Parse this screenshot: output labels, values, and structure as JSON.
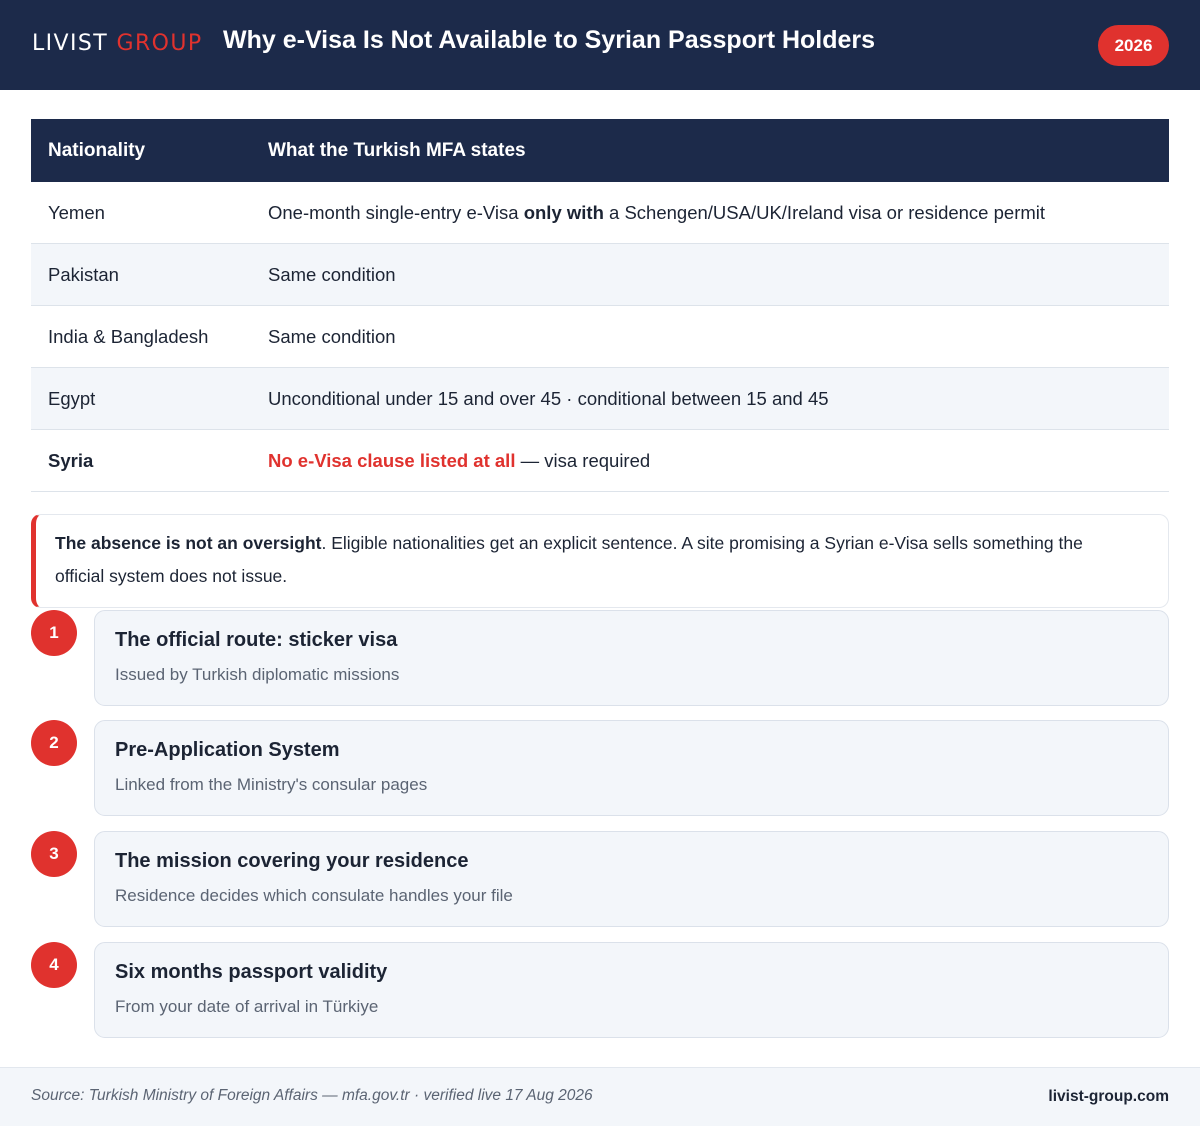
{
  "header": {
    "brand_main": "LIVIST",
    "brand_accent": "GROUP",
    "title": "Why e-Visa Is Not Available to Syrian Passport Holders",
    "year": "2026"
  },
  "table": {
    "col1": "Nationality",
    "col2": "What the Turkish MFA states",
    "rows": [
      {
        "nationality": "Yemen",
        "pre": "One-month single-entry e-Visa ",
        "bold": "only with",
        "post": " a Schengen/USA/UK/Ireland visa or residence permit"
      },
      {
        "nationality": "Pakistan",
        "statement": "Same condition"
      },
      {
        "nationality": "India & Bangladesh",
        "statement": "Same condition"
      },
      {
        "nationality": "Egypt",
        "statement": "Unconditional under 15 and over 45 · conditional between 15 and 45"
      },
      {
        "nationality": "Syria",
        "highlight": "No e-Visa clause listed at all",
        "rest": " — visa required"
      }
    ]
  },
  "callout": {
    "bold": "The absence is not an oversight",
    "text": ". Eligible nationalities get an explicit sentence. A site promising a Syrian e-Visa sells something the official system does not issue."
  },
  "steps": [
    {
      "num": "1",
      "title": "The official route: sticker visa",
      "sub": "Issued by Turkish diplomatic missions"
    },
    {
      "num": "2",
      "title": "Pre-Application System",
      "sub": "Linked from the Ministry's consular pages"
    },
    {
      "num": "3",
      "title": "The mission covering your residence",
      "sub": "Residence decides which consulate handles your file"
    },
    {
      "num": "4",
      "title": "Six months passport validity",
      "sub": "From your date of arrival in Türkiye"
    }
  ],
  "footer": {
    "source": "Source: Turkish Ministry of Foreign Affairs — mfa.gov.tr · verified live 17 Aug 2026",
    "site": "livist-group.com"
  },
  "colors": {
    "navy": "#1c2a4a",
    "accent": "#e0322e",
    "row_alt": "#f3f6fa"
  }
}
